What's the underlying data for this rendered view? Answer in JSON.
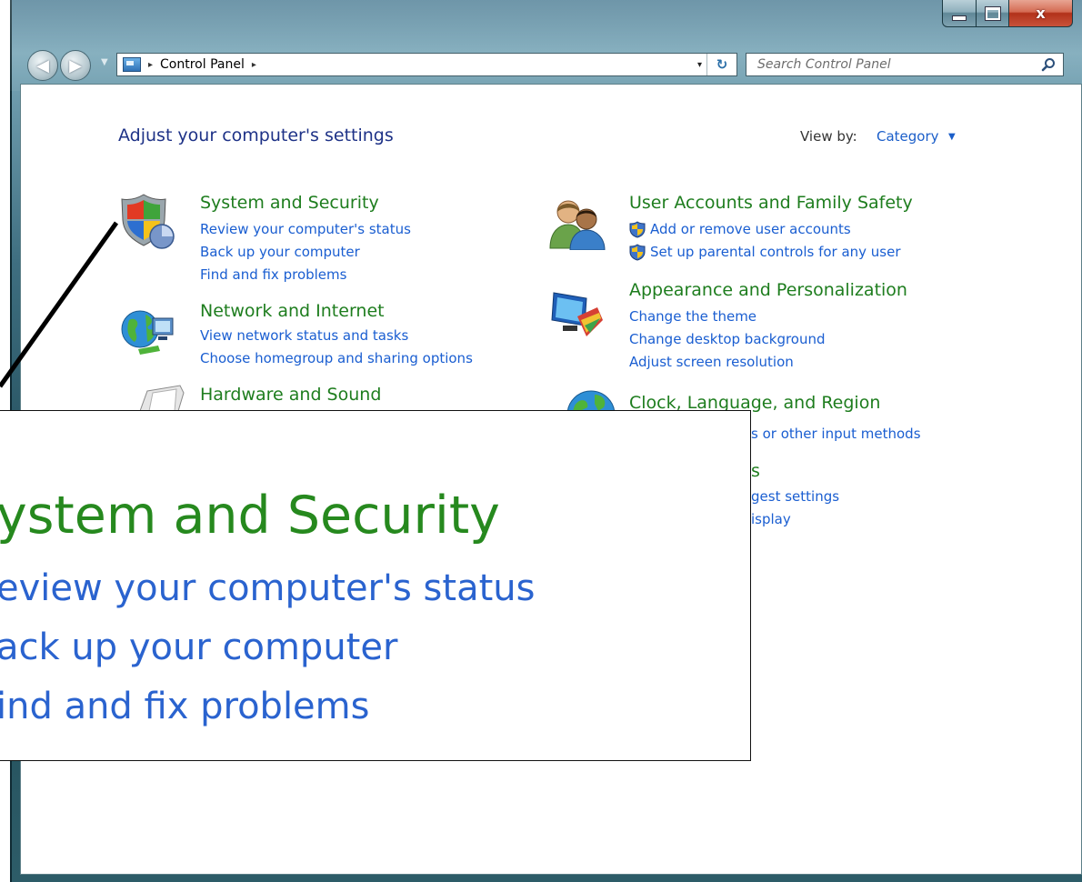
{
  "window": {
    "caption_buttons": {
      "minimize_icon": "minimize-icon",
      "maximize_icon": "maximize-icon",
      "close_label": "x"
    }
  },
  "address": {
    "location_icon": "control-panel-icon",
    "path": "Control Panel",
    "separator": "▸",
    "dropdown": "▾",
    "refresh": "↻"
  },
  "search": {
    "placeholder": "Search Control Panel"
  },
  "content": {
    "title": "Adjust your computer's settings",
    "view_by_label": "View by:",
    "view_by_value": "Category",
    "view_by_arrow": "▼"
  },
  "categories": {
    "system": {
      "title": "System and Security",
      "links": [
        "Review your computer's status",
        "Back up your computer",
        "Find and fix problems"
      ]
    },
    "network": {
      "title": "Network and Internet",
      "links": [
        "View network status and tasks",
        "Choose homegroup and sharing options"
      ]
    },
    "hardware": {
      "title": "Hardware and Sound"
    },
    "users": {
      "title": "User Accounts and Family Safety",
      "links": [
        "Add or remove user accounts",
        "Set up parental controls for any user"
      ]
    },
    "appearance": {
      "title": "Appearance and Personalization",
      "links": [
        "Change the theme",
        "Change desktop background",
        "Adjust screen resolution"
      ]
    },
    "clock": {
      "title": "Clock, Language, and Region",
      "partial_link": "s or other input methods"
    },
    "ease": {
      "partial_title": "s",
      "partial_links": [
        "gest settings",
        "isplay"
      ]
    }
  },
  "zoom": {
    "title": "ystem and Security",
    "links": [
      "eview your computer's status",
      "ack up your computer",
      "ind and fix problems"
    ]
  },
  "colors": {
    "category_title": "#1e7d1e",
    "link": "#1a5ed1",
    "heading": "#1e3287"
  }
}
